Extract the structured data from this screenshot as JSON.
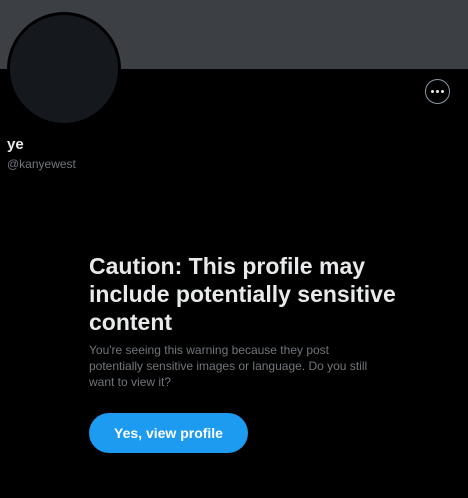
{
  "profile": {
    "display_name": "ye",
    "handle": "@kanyewest"
  },
  "header": {
    "more_icon": "more-horizontal-icon"
  },
  "warning": {
    "title": "Caution: This profile may include potentially sensitive content",
    "description": "You're seeing this warning because they post potentially sensitive images or language. Do you still want to view it?",
    "button_label": "Yes, view profile"
  },
  "colors": {
    "background": "#000000",
    "banner": "#3c3f43",
    "accent": "#1d9bf0",
    "secondary_text": "#71767b"
  }
}
